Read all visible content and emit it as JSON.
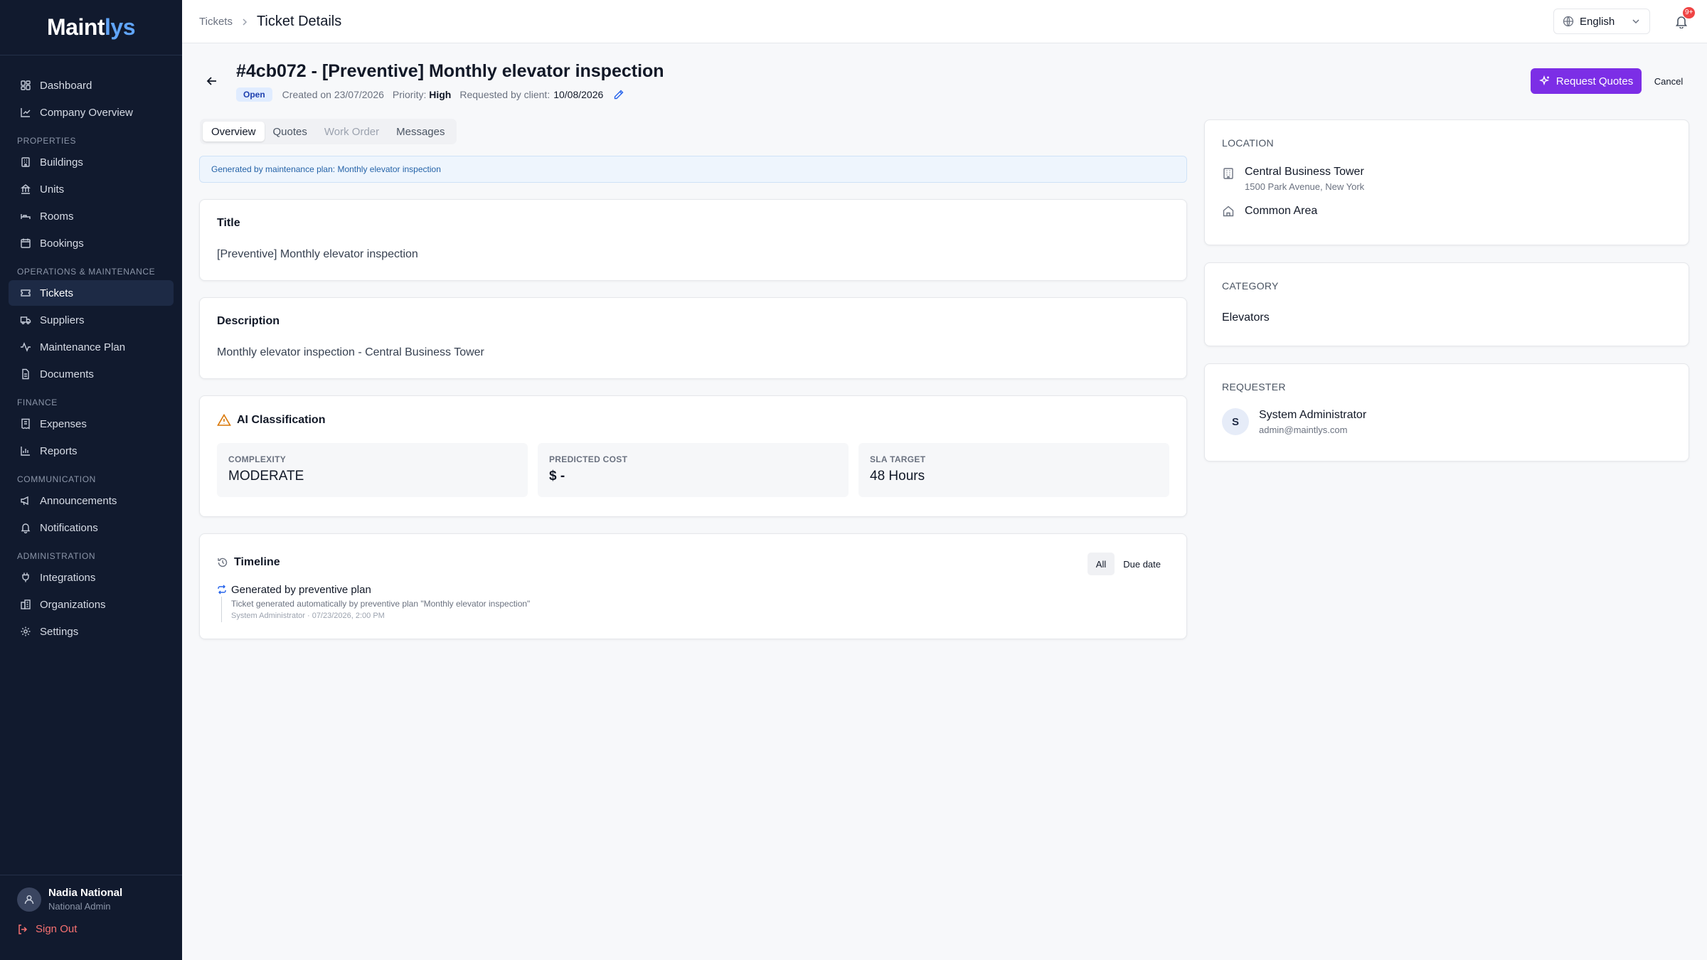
{
  "app": {
    "logo_main": "Maint",
    "logo_accent": "lys"
  },
  "sidebar": {
    "items": [
      {
        "label": "Dashboard"
      },
      {
        "label": "Company Overview"
      },
      {
        "label": "Buildings"
      },
      {
        "label": "Units"
      },
      {
        "label": "Rooms"
      },
      {
        "label": "Bookings"
      },
      {
        "label": "Tickets"
      },
      {
        "label": "Suppliers"
      },
      {
        "label": "Maintenance Plan"
      },
      {
        "label": "Documents"
      },
      {
        "label": "Expenses"
      },
      {
        "label": "Reports"
      },
      {
        "label": "Announcements"
      },
      {
        "label": "Notifications"
      },
      {
        "label": "Integrations"
      },
      {
        "label": "Organizations"
      },
      {
        "label": "Settings"
      }
    ],
    "sections": {
      "properties": "PROPERTIES",
      "operations": "OPERATIONS & MAINTENANCE",
      "finance": "FINANCE",
      "communication": "COMMUNICATION",
      "administration": "ADMINISTRATION"
    },
    "user": {
      "name": "Nadia National",
      "role": "National Admin",
      "sign_out": "Sign Out"
    }
  },
  "header": {
    "breadcrumb_parent": "Tickets",
    "breadcrumb_current": "Ticket Details",
    "language": "English",
    "notification_badge": "9+"
  },
  "ticket": {
    "title": "#4cb072 - [Preventive] Monthly elevator inspection",
    "status": "Open",
    "created": "Created on 23/07/2026",
    "priority_label": "Priority:",
    "priority_value": "High",
    "requested_label": "Requested by client:",
    "requested_value": "10/08/2026",
    "request_quotes": "Request Quotes",
    "cancel": "Cancel"
  },
  "tabs": [
    {
      "label": "Overview"
    },
    {
      "label": "Quotes"
    },
    {
      "label": "Work Order"
    },
    {
      "label": "Messages"
    }
  ],
  "banner": "Generated by maintenance plan: Monthly elevator inspection",
  "title_card": {
    "label": "Title",
    "value": "[Preventive] Monthly elevator inspection"
  },
  "description_card": {
    "label": "Description",
    "value": "Monthly elevator inspection - Central Business Tower"
  },
  "ai": {
    "label": "AI Classification",
    "complexity_label": "COMPLEXITY",
    "complexity_value": "MODERATE",
    "cost_label": "PREDICTED COST",
    "cost_value": "$ -",
    "sla_label": "SLA TARGET",
    "sla_value": "48 Hours"
  },
  "timeline": {
    "label": "Timeline",
    "filter_all": "All",
    "filter_due": "Due date",
    "entry": {
      "title": "Generated by preventive plan",
      "desc": "Ticket generated automatically by preventive plan \"Monthly elevator inspection\"",
      "meta": "System Administrator · 07/23/2026, 2:00 PM"
    }
  },
  "location": {
    "label": "LOCATION",
    "building": "Central Business Tower",
    "address": "1500 Park Avenue, New York",
    "area": "Common Area"
  },
  "category": {
    "label": "CATEGORY",
    "value": "Elevators"
  },
  "requester": {
    "label": "REQUESTER",
    "initial": "S",
    "name": "System Administrator",
    "email": "admin@maintlys.com"
  },
  "colors": {
    "sidebar_bg": "#111a2e",
    "accent_purple": "#7c2ee6",
    "status_blue": "#1e40af",
    "warning": "#d97706"
  }
}
